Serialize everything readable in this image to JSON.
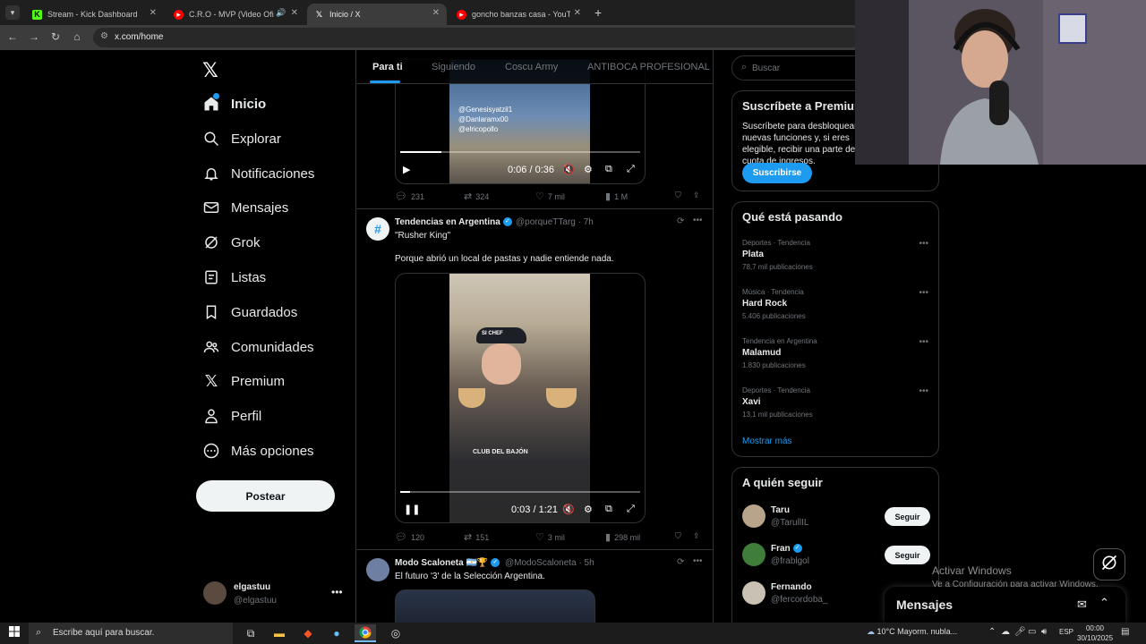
{
  "browser": {
    "tabs": [
      {
        "label": "Stream - Kick Dashboard",
        "active": false
      },
      {
        "label": "C.R.O - MVP (Video Oficial)",
        "active": false
      },
      {
        "label": "Inicio / X",
        "active": true
      },
      {
        "label": "goncho banzas casa - YouTube",
        "active": false
      }
    ],
    "url": "x.com/home"
  },
  "nav": {
    "items": [
      {
        "label": "Inicio",
        "icon": "home-icon"
      },
      {
        "label": "Explorar",
        "icon": "search-icon"
      },
      {
        "label": "Notificaciones",
        "icon": "bell-icon"
      },
      {
        "label": "Mensajes",
        "icon": "mail-icon"
      },
      {
        "label": "Grok",
        "icon": "grok-icon"
      },
      {
        "label": "Listas",
        "icon": "list-icon"
      },
      {
        "label": "Guardados",
        "icon": "bookmark-icon"
      },
      {
        "label": "Comunidades",
        "icon": "people-icon"
      },
      {
        "label": "Premium",
        "icon": "x-logo-icon"
      },
      {
        "label": "Perfil",
        "icon": "person-icon"
      },
      {
        "label": "Más opciones",
        "icon": "more-circle-icon"
      }
    ],
    "post_label": "Postear",
    "profile": {
      "name": "elgastuu",
      "handle": "@elgastuu"
    }
  },
  "feed": {
    "tabs": [
      "Para ti",
      "Siguiendo",
      "Coscu Army",
      "ANTIBOCA PROFESIONAL"
    ],
    "tweet1": {
      "watermark": [
        "@Genesisyatzil1",
        "@Danlaramx00",
        "@elricopollo"
      ],
      "time": "0:06 / 0:36",
      "progress": 0.17,
      "replies": "231",
      "reposts": "324",
      "likes": "7 mil",
      "views": "1 M"
    },
    "tweet2": {
      "name": "Tendencias en Argentina",
      "handle": "@porqueTTarg",
      "age": "· 7h",
      "quote": "\"Rusher King\"",
      "text": "Porque abrió un local de pastas y nadie entiende nada.",
      "video_caption": "CLUB DEL BAJÓN",
      "cap_text": "SI CHEF",
      "time": "0:03 / 1:21",
      "progress": 0.04,
      "replies": "120",
      "reposts": "151",
      "likes": "3 mil",
      "views": "298 mil"
    },
    "tweet3": {
      "name": "Modo Scaloneta 🇦🇷🏆",
      "handle": "@ModoScaloneta",
      "age": "· 5h",
      "text": "El futuro '3' de la Selección Argentina."
    }
  },
  "right": {
    "search_placeholder": "Buscar",
    "premium": {
      "title": "Suscríbete a Premium",
      "desc": "Suscríbete para desbloquear nuevas funciones y, si eres elegible, recibir una parte de cuota de ingresos.",
      "button": "Suscribirse"
    },
    "trends_title": "Qué está pasando",
    "trends": [
      {
        "category": "Deportes · Tendencia",
        "name": "Plata",
        "count": "78,7 mil publicaciones"
      },
      {
        "category": "Música · Tendencia",
        "name": "Hard Rock",
        "count": "5.406 publicaciones"
      },
      {
        "category": "Tendencia en Argentina",
        "name": "Malamud",
        "count": "1.830 publicaciones"
      },
      {
        "category": "Deportes · Tendencia",
        "name": "Xavi",
        "count": "13,1 mil publicaciones"
      }
    ],
    "show_more": "Mostrar más",
    "follow_title": "A quién seguir",
    "follow": [
      {
        "name": "Taru",
        "handle": "@TarullIL",
        "button": "Seguir"
      },
      {
        "name": "Fran",
        "handle": "@frablgol",
        "button": "Seguir"
      },
      {
        "name": "Fernando",
        "handle": "@fercordoba_",
        "button": "Seguir"
      }
    ]
  },
  "messages_label": "Mensajes",
  "windows": {
    "activate_title": "Activar Windows",
    "activate_sub": "Ve a Configuración para activar Windows.",
    "search_placeholder": "Escribe aquí para buscar.",
    "weather": "10°C  Mayorm. nubla...",
    "lang": "ESP",
    "time": "00:00",
    "date": "30/10/2025"
  },
  "colors": {
    "accent": "#1d9bf0",
    "background": "#000000",
    "border": "#2f3336",
    "muted": "#71767b"
  }
}
